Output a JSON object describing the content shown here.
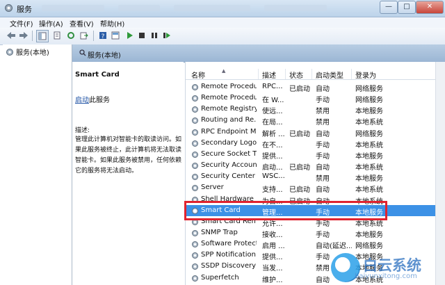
{
  "window": {
    "title": "服务",
    "buttons": {
      "minimize": "—",
      "maximize": "□",
      "close": "✕"
    }
  },
  "menu": [
    "文件(F)",
    "操作(A)",
    "查看(V)",
    "帮助(H)"
  ],
  "tree": {
    "root": "服务(本地)"
  },
  "header": {
    "title": "服务(本地)"
  },
  "details": {
    "service_name": "Smart Card",
    "start_link": "启动",
    "start_suffix": "此服务",
    "desc_label": "描述:",
    "desc_text": "管理此计算机对智能卡的取读访问。如果此服务被终止，此计算机将无法取读智能卡。如果此服务被禁用，任何依赖它的服务将无法启动。"
  },
  "columns": [
    "名称",
    "描述",
    "状态",
    "启动类型",
    "登录为"
  ],
  "services": [
    {
      "name": "Remote Procedu...",
      "desc": "RPC...",
      "status": "已启动",
      "startup": "自动",
      "logon": "网络服务"
    },
    {
      "name": "Remote Procedu...",
      "desc": "在 W...",
      "status": "",
      "startup": "手动",
      "logon": "网络服务"
    },
    {
      "name": "Remote Registry",
      "desc": "使远...",
      "status": "",
      "startup": "禁用",
      "logon": "本地服务"
    },
    {
      "name": "Routing and Re...",
      "desc": "在局...",
      "status": "",
      "startup": "禁用",
      "logon": "本地系统"
    },
    {
      "name": "RPC Endpoint M...",
      "desc": "解析 ...",
      "status": "已启动",
      "startup": "自动",
      "logon": "网络服务"
    },
    {
      "name": "Secondary Logon",
      "desc": "在不...",
      "status": "",
      "startup": "手动",
      "logon": "本地系统"
    },
    {
      "name": "Secure Socket T...",
      "desc": "提供...",
      "status": "",
      "startup": "手动",
      "logon": "本地服务"
    },
    {
      "name": "Security Account...",
      "desc": "启动...",
      "status": "已启动",
      "startup": "自动",
      "logon": "本地系统"
    },
    {
      "name": "Security Center",
      "desc": "WSC...",
      "status": "",
      "startup": "禁用",
      "logon": "本地服务"
    },
    {
      "name": "Server",
      "desc": "支持...",
      "status": "已启动",
      "startup": "自动",
      "logon": "本地系统"
    },
    {
      "name": "Shell Hardware ...",
      "desc": "为自...",
      "status": "已启动",
      "startup": "自动",
      "logon": "本地系统"
    },
    {
      "name": "Smart Card",
      "desc": "管理...",
      "status": "",
      "startup": "手动",
      "logon": "本地服务",
      "selected": true
    },
    {
      "name": "Smart Card Rem...",
      "desc": "允许...",
      "status": "",
      "startup": "手动",
      "logon": "本地系统"
    },
    {
      "name": "SNMP Trap",
      "desc": "接收...",
      "status": "",
      "startup": "手动",
      "logon": "本地服务"
    },
    {
      "name": "Software Protect...",
      "desc": "启用 ...",
      "status": "",
      "startup": "自动(延迟...",
      "logon": "网络服务"
    },
    {
      "name": "SPP Notification ...",
      "desc": "提供...",
      "status": "",
      "startup": "手动",
      "logon": "本地服务"
    },
    {
      "name": "SSDP Discovery",
      "desc": "当发...",
      "status": "",
      "startup": "禁用",
      "logon": "本地服务"
    },
    {
      "name": "Superfetch",
      "desc": "维护...",
      "status": "",
      "startup": "自动",
      "logon": "本地系统"
    }
  ],
  "watermark": {
    "text": "白云系统",
    "sub": "baiyunxitong.com"
  },
  "colors": {
    "selection": "#3c91e6",
    "highlight_box": "#e0232f"
  }
}
